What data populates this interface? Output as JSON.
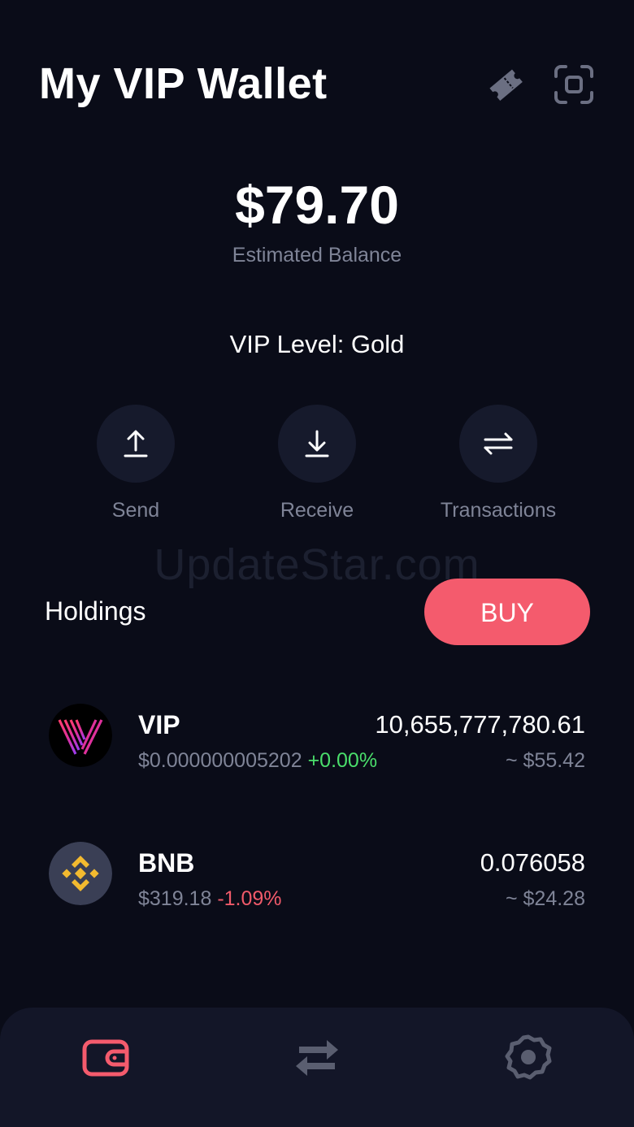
{
  "header": {
    "title": "My VIP Wallet"
  },
  "balance": {
    "amount": "$79.70",
    "label": "Estimated Balance"
  },
  "vip_level": "VIP Level: Gold",
  "actions": {
    "send": "Send",
    "receive": "Receive",
    "transactions": "Transactions"
  },
  "watermark": "UpdateStar.com",
  "holdings": {
    "title": "Holdings",
    "buy_label": "BUY",
    "tokens": [
      {
        "symbol": "VIP",
        "price": "$0.000000005202",
        "change": "+0.00%",
        "amount": "10,655,777,780.61",
        "value": "~ $55.42"
      },
      {
        "symbol": "BNB",
        "price": "$319.18",
        "change": "-1.09%",
        "amount": "0.076058",
        "value": "~ $24.28"
      }
    ]
  },
  "colors": {
    "background": "#0a0c18",
    "accent": "#f45b6d",
    "positive": "#4ade6b",
    "negative": "#f05a6a",
    "muted_text": "#7f8497",
    "bnb_yellow": "#f3ba2f"
  },
  "icons": {
    "header": [
      "ticket-icon",
      "scan-icon"
    ],
    "actions": [
      "upload-arrow-icon",
      "download-arrow-icon",
      "swap-arrows-icon"
    ],
    "nav": [
      "wallet-icon",
      "swap-icon",
      "settings-gear-icon"
    ]
  }
}
